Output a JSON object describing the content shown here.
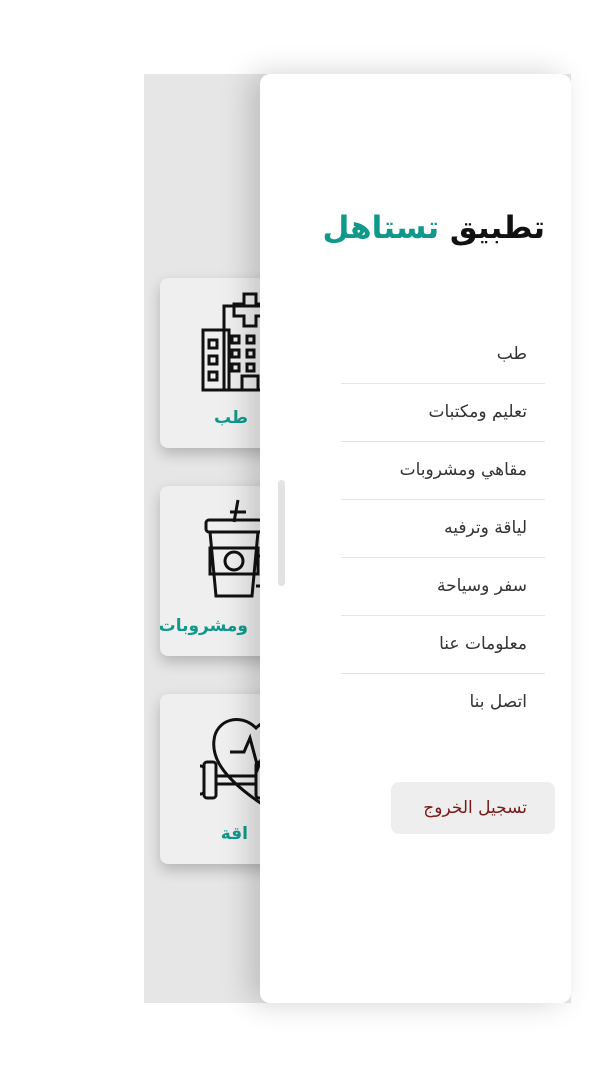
{
  "app": {
    "title_prefix": "تطبيق",
    "title_name": "تستاهل",
    "accent_color": "#10998b"
  },
  "background_cards": [
    {
      "label": "طب",
      "icon": "hospital-icon"
    },
    {
      "label": "ومشروبات",
      "icon": "coffee-cup-icon"
    },
    {
      "label": "اقة",
      "icon": "fitness-heart-dumbbell-icon"
    }
  ],
  "drawer": {
    "menu_items": [
      {
        "label": "طب"
      },
      {
        "label": "تعليم ومكتبات"
      },
      {
        "label": "مقاهي ومشروبات"
      },
      {
        "label": "لياقة وترفيه"
      },
      {
        "label": "سفر وسياحة"
      },
      {
        "label": "معلومات عنا"
      },
      {
        "label": "اتصل بنا"
      }
    ],
    "logout_label": "تسجيل الخروج",
    "logout_color": "#7a1a1a"
  }
}
